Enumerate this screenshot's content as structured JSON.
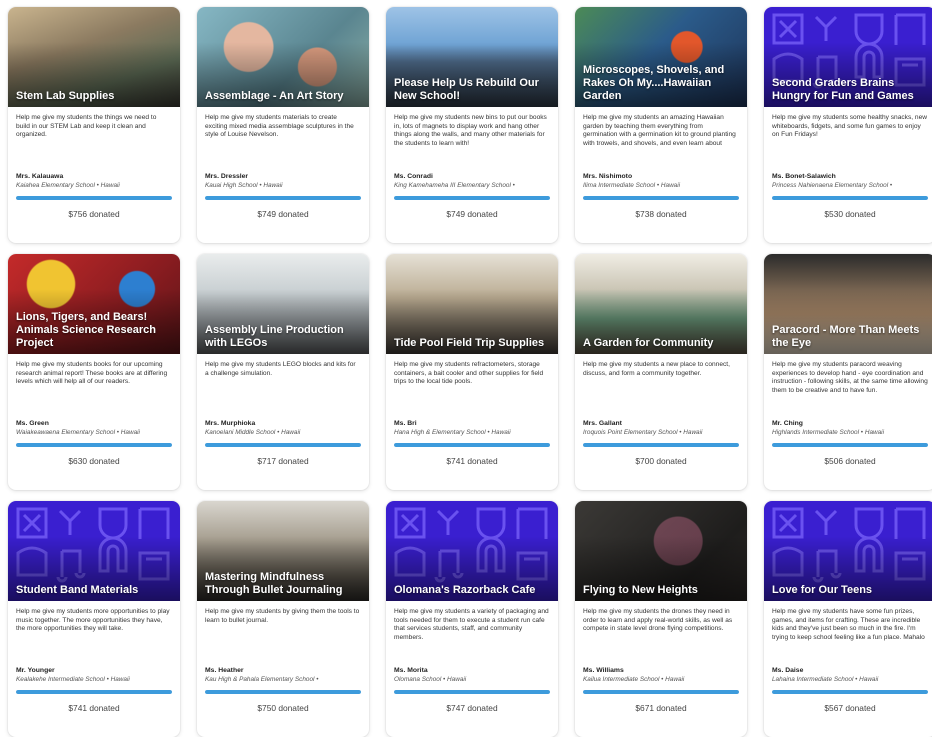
{
  "colors": {
    "progress": "#3d9bdc",
    "pattern_bg": "#3a1fd0",
    "pattern_line": "#6a52f0"
  },
  "cards": [
    {
      "title": "Stem Lab Supplies",
      "description": "Help me give my students the things we need to build in our STEM Lab and keep it clean and organized.",
      "teacher": "Mrs. Kalauawa",
      "school": "Kaiahea Elementary School • Hawaii",
      "donated": "$756 donated",
      "progress": 1.0,
      "image": "photo-classroom",
      "bg": "#8a7a66"
    },
    {
      "title": "Assemblage - An Art Story",
      "description": "Help me give my students materials to create exciting mixed media assemblage sculptures in the style of Louise Nevelson.",
      "teacher": "Mrs. Dressler",
      "school": "Kauai High School • Hawaii",
      "donated": "$749 donated",
      "progress": 1.0,
      "image": "photo-mural",
      "bg": "#6f9aa6"
    },
    {
      "title": "Please Help Us Rebuild Our New School!",
      "description": "Help me give my students new bins to put our books in, lots of magnets to display work and hang other things along the walls, and many other materials for the students to learn with!",
      "teacher": "Ms. Conradi",
      "school": "King Kamehameha III Elementary School •",
      "donated": "$749 donated",
      "progress": 1.0,
      "image": "photo-students",
      "bg": "#5a7fa8"
    },
    {
      "title": "Microscopes, Shovels, and Rakes Oh My....Hawaiian Garden",
      "description": "Help me give my students an amazing Hawaiian garden by teaching them everything from germination with a germination kit to ground planting with trowels, and shovels, and even learn about",
      "teacher": "Mrs. Nishimoto",
      "school": "Ilima Intermediate School • Hawaii",
      "donated": "$738 donated",
      "progress": 1.0,
      "image": "photo-garden-art",
      "bg": "#2d4f7a"
    },
    {
      "title": "Second Graders Brains Hungry for Fun and Games",
      "description": "Help me give my students some healthy snacks, new whiteboards, fidgets, and some fun games to enjoy on Fun Fridays!",
      "teacher": "Ms. Bonet-Salawich",
      "school": "Princess Nahienaena Elementary School •",
      "donated": "$530 donated",
      "progress": 1.0,
      "image": "pattern",
      "bg": "#3a1fd0"
    },
    {
      "title": "Lions, Tigers, and Bears! Animals Science Research Project",
      "description": "Help me give my students books for our upcoming research animal report! These books are at differing levels which will help all of our readers.",
      "teacher": "Ms. Green",
      "school": "Waiakeawaena Elementary School • Hawaii",
      "donated": "$630 donated",
      "progress": 1.0,
      "image": "photo-toys",
      "bg": "#b8252a"
    },
    {
      "title": "Assembly Line Production with LEGOs",
      "description": "Help me give my students LEGO blocks and kits for a challenge simulation.",
      "teacher": "Mrs. Murphioka",
      "school": "Kanoelani Middle School • Hawaii",
      "donated": "$717 donated",
      "progress": 1.0,
      "image": "photo-room",
      "bg": "#a0a8ad"
    },
    {
      "title": "Tide Pool Field Trip Supplies",
      "description": "Help me give my students refractometers, storage containers, a bait cooler and other supplies for field trips to the local tide pools.",
      "teacher": "Ms. Bri",
      "school": "Hana High & Elementary School • Hawaii",
      "donated": "$741 donated",
      "progress": 1.0,
      "image": "photo-lab",
      "bg": "#8d8478"
    },
    {
      "title": "A Garden for Community",
      "description": "Help me give my students a new place to connect, discuss, and form a community together.",
      "teacher": "Mrs. Gallant",
      "school": "Iroquois Point Elementary School • Hawaii",
      "donated": "$700 donated",
      "progress": 1.0,
      "image": "photo-classroom2",
      "bg": "#9c9484"
    },
    {
      "title": "Paracord - More Than Meets the Eye",
      "description": "Help me give my students paracord weaving experiences to develop hand - eye coordination and instruction - following skills, at the same time allowing them to be creative and to have fun.",
      "teacher": "Mr. Ching",
      "school": "Highlands Intermediate School • Hawaii",
      "donated": "$506 donated",
      "progress": 1.0,
      "image": "photo-shop",
      "bg": "#6e5a4c"
    },
    {
      "title": "Student Band Materials",
      "description": "Help me give my students more opportunities to play music together. The more opportunities they have, the more opportunities they will take.",
      "teacher": "Mr. Younger",
      "school": "Kealakehe Intermediate School • Hawaii",
      "donated": "$741 donated",
      "progress": 1.0,
      "image": "pattern",
      "bg": "#3a1fd0"
    },
    {
      "title": "Mastering Mindfulness Through Bullet Journaling",
      "description": "Help me give my students by giving them the tools to learn to bullet journal.",
      "teacher": "Ms. Heather",
      "school": "Kau High & Pahala Elementary School •",
      "donated": "$750 donated",
      "progress": 1.0,
      "image": "photo-hall",
      "bg": "#7b7466"
    },
    {
      "title": "Olomana's Razorback Cafe",
      "description": "Help me give my students a variety of packaging and tools needed for them to execute a student run cafe that services students, staff, and community members.",
      "teacher": "Ms. Morita",
      "school": "Olomana School • Hawaii",
      "donated": "$747 donated",
      "progress": 1.0,
      "image": "pattern",
      "bg": "#3a1fd0"
    },
    {
      "title": "Flying to New Heights",
      "description": "Help me give my students the drones they need in order to learn and apply real-world skills, as well as compete in state level drone flying competitions.",
      "teacher": "Ms. Williams",
      "school": "Kailua Intermediate School • Hawaii",
      "donated": "$671 donated",
      "progress": 1.0,
      "image": "photo-chalkboard",
      "bg": "#2a2826"
    },
    {
      "title": "Love for Our Teens",
      "description": "Help me give my students have some fun prizes, games, and items for crafting. These are incredible kids and they've just been so much in the fire. I'm trying to keep school feeling like a fun place. Mahalo",
      "teacher": "Ms. Daise",
      "school": "Lahaina Intermediate School • Hawaii",
      "donated": "$567 donated",
      "progress": 1.0,
      "image": "pattern",
      "bg": "#3a1fd0"
    }
  ]
}
